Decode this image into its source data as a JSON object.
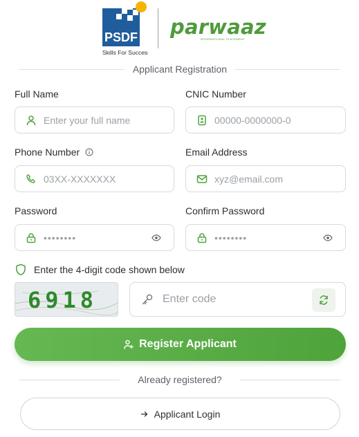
{
  "brand": {
    "psdf_text": "PSDF",
    "psdf_tagline": "Skills For Success",
    "parwaaz_text": "parwaaz",
    "parwaaz_subtitle": "INTERNATIONAL PLACEMENT"
  },
  "form": {
    "title": "Applicant Registration",
    "full_name": {
      "label": "Full Name",
      "placeholder": "Enter your full name",
      "icon": "user-icon"
    },
    "cnic": {
      "label": "CNIC Number",
      "placeholder": "00000-0000000-0",
      "icon": "id-card-icon"
    },
    "phone": {
      "label": "Phone Number",
      "placeholder": "03XX-XXXXXXX",
      "icon": "phone-icon"
    },
    "email": {
      "label": "Email Address",
      "placeholder": "xyz@email.com",
      "icon": "mail-icon"
    },
    "password": {
      "label": "Password",
      "value": "••••••••",
      "icon": "lock-icon"
    },
    "confirm_password": {
      "label": "Confirm Password",
      "value": "••••••••",
      "icon": "lock-icon"
    }
  },
  "captcha": {
    "label": "Enter the 4-digit code shown below",
    "code": "6918",
    "placeholder": "Enter code"
  },
  "actions": {
    "register_label": "Register Applicant",
    "already_registered": "Already registered?",
    "login_label": "Applicant Login"
  },
  "colors": {
    "accent": "#4fa33b",
    "accent_light": "#66b852",
    "border": "#d6d9dd",
    "placeholder": "#9aa0a6"
  }
}
